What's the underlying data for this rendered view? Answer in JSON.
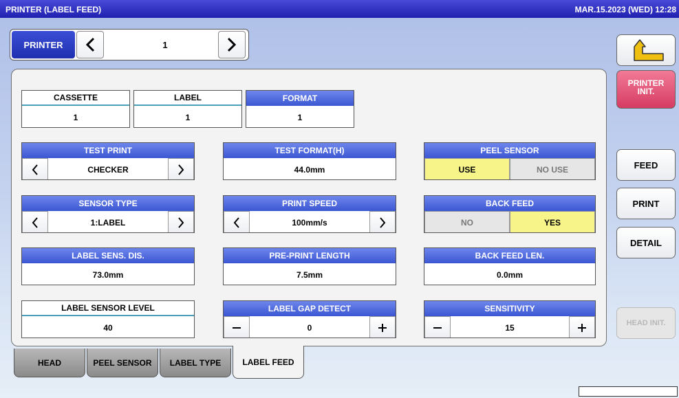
{
  "title": {
    "left": "PRINTER (LABEL FEED)",
    "datetime": "MAR.15.2023 (WED) 12:28"
  },
  "printer": {
    "label": "PRINTER",
    "value": "1"
  },
  "side_buttons": {
    "printer_init": "PRINTER\nINIT.",
    "feed": "FEED",
    "print": "PRINT",
    "detail": "DETAIL",
    "head_init": "HEAD INIT."
  },
  "top_fields": {
    "cassette": {
      "label": "CASSETTE",
      "value": "1"
    },
    "label": {
      "label": "LABEL",
      "value": "1"
    },
    "format": {
      "label": "FORMAT",
      "value": "1"
    }
  },
  "fields": {
    "test_print": {
      "label": "TEST PRINT",
      "value": "CHECKER"
    },
    "test_format": {
      "label": "TEST FORMAT(H)",
      "value": "44.0mm"
    },
    "peel_sensor": {
      "label": "PEEL SENSOR",
      "opt1": "USE",
      "opt2": "NO USE",
      "selected": "USE"
    },
    "sensor_type": {
      "label": "SENSOR TYPE",
      "value": "1:LABEL"
    },
    "print_speed": {
      "label": "PRINT SPEED",
      "value": "100mm/s"
    },
    "back_feed": {
      "label": "BACK FEED",
      "opt1": "NO",
      "opt2": "YES",
      "selected": "YES"
    },
    "label_sens_dis": {
      "label": "LABEL SENS. DIS.",
      "value": "73.0mm"
    },
    "pre_print_length": {
      "label": "PRE-PRINT LENGTH",
      "value": "7.5mm"
    },
    "back_feed_len": {
      "label": "BACK FEED LEN.",
      "value": "0.0mm"
    },
    "label_sensor_level": {
      "label": "LABEL SENSOR LEVEL",
      "value": "40"
    },
    "label_gap_detect": {
      "label": "LABEL GAP DETECT",
      "value": "0"
    },
    "sensitivity": {
      "label": "SENSITIVITY",
      "value": "15"
    }
  },
  "tabs": [
    {
      "label": "HEAD"
    },
    {
      "label": "PEEL SENSOR"
    },
    {
      "label": "LABEL TYPE"
    },
    {
      "label": "LABEL FEED"
    }
  ],
  "active_tab": "LABEL FEED",
  "colors": {
    "title_bar": "#2020b0",
    "header_blue": "#3b56d2",
    "selected_yellow": "#f7f58a",
    "init_red": "#d63c63"
  },
  "icons": {
    "arrow_left": "chevron-left-icon",
    "arrow_right": "chevron-right-icon",
    "back": "return-arrow-icon",
    "minus": "minus-icon",
    "plus": "plus-icon"
  }
}
